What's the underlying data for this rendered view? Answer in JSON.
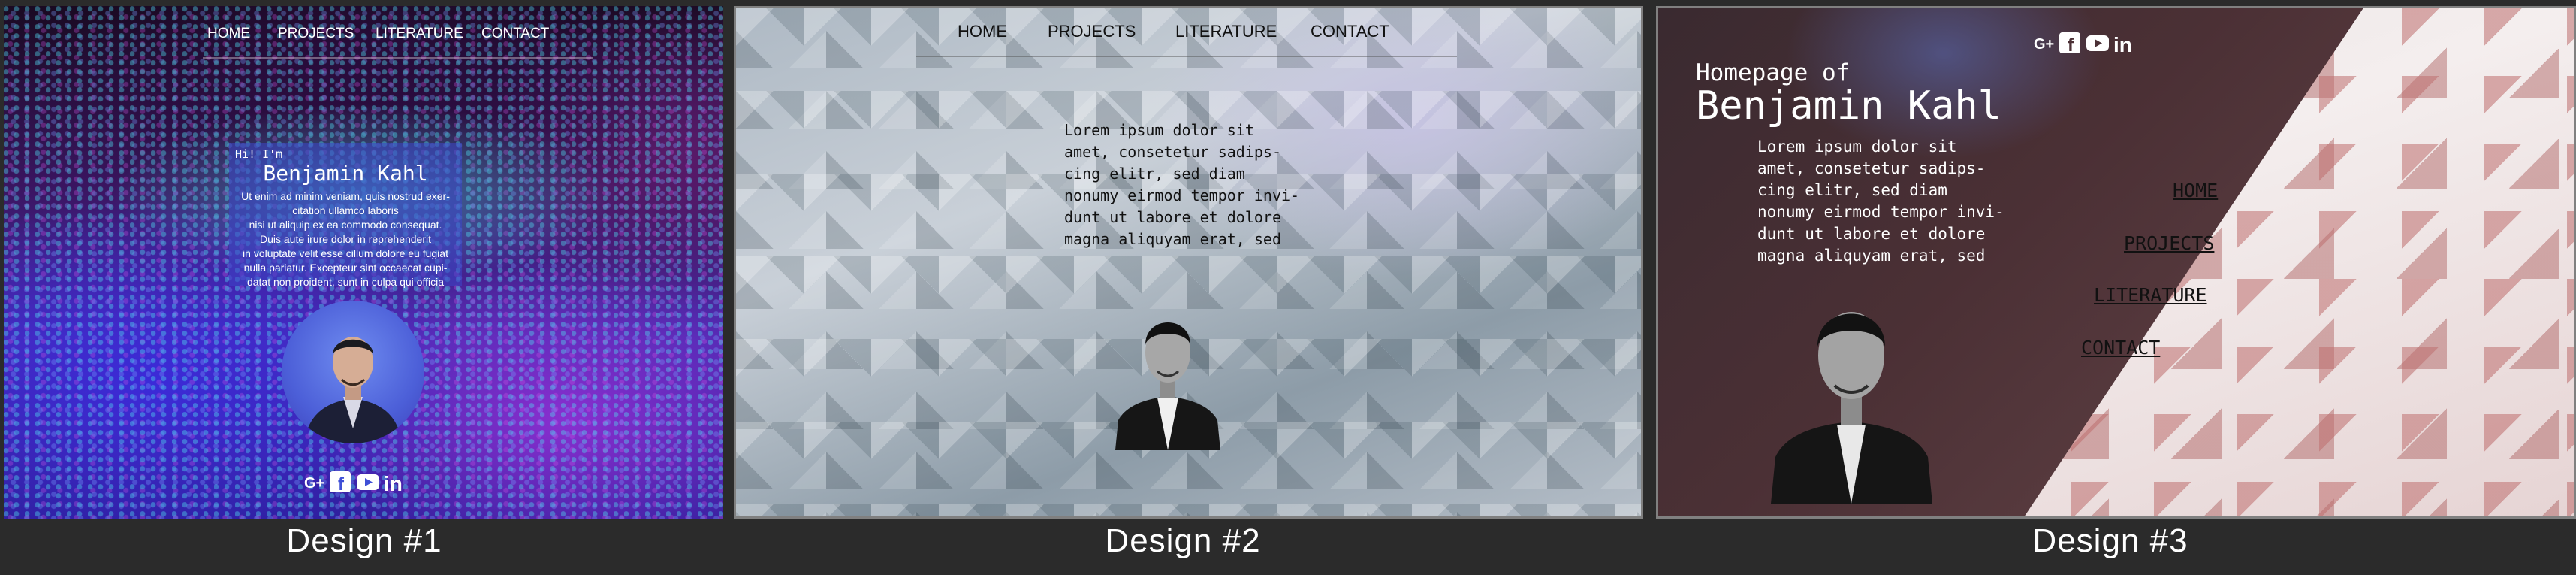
{
  "colors": {
    "background": "#2b2b2b",
    "caption_text": "#ffffff",
    "design1_accent": "#4a5ee0",
    "design3_menu_text": "#111111"
  },
  "captions": [
    "Design  #1",
    "Design  #2",
    "Design  #3"
  ],
  "design1": {
    "nav": [
      "HOME",
      "PROJECTS",
      "LITERATURE",
      "CONTACT"
    ],
    "greeting": "Hi! I'm",
    "name": "Benjamin Kahl",
    "paragraph_lines": [
      "Ut enim ad minim veniam, quis nostrud exer-",
      "citation ullamco laboris",
      "nisi ut aliquip ex ea commodo consequat.",
      "Duis aute irure dolor in reprehenderit",
      "in voluptate velit esse cillum dolore eu fugiat",
      "nulla pariatur. Excepteur sint occaecat cupi-",
      "datat non proident, sunt in culpa qui officia"
    ],
    "social_icons": [
      "google-plus-icon",
      "facebook-icon",
      "youtube-icon",
      "linkedin-icon"
    ]
  },
  "design2": {
    "nav": [
      "HOME",
      "PROJECTS",
      "LITERATURE",
      "CONTACT"
    ],
    "paragraph_lines": [
      "Lorem ipsum dolor sit",
      "amet, consetetur sadips-",
      "cing elitr, sed diam",
      "nonumy eirmod tempor invi-",
      "dunt ut labore et dolore",
      "magna aliquyam erat, sed"
    ]
  },
  "design3": {
    "subtitle": "Homepage of",
    "name": "Benjamin Kahl",
    "paragraph_lines": [
      "Lorem ipsum dolor sit",
      "amet, consetetur sadips-",
      "cing elitr, sed diam",
      "nonumy eirmod tempor invi-",
      "dunt ut labore et dolore",
      "magna aliquyam erat, sed"
    ],
    "menu": [
      "HOME",
      "PROJECTS",
      "LITERATURE",
      "CONTACT"
    ],
    "social_icons": [
      "google-plus-icon",
      "facebook-icon",
      "youtube-icon",
      "linkedin-icon"
    ]
  }
}
